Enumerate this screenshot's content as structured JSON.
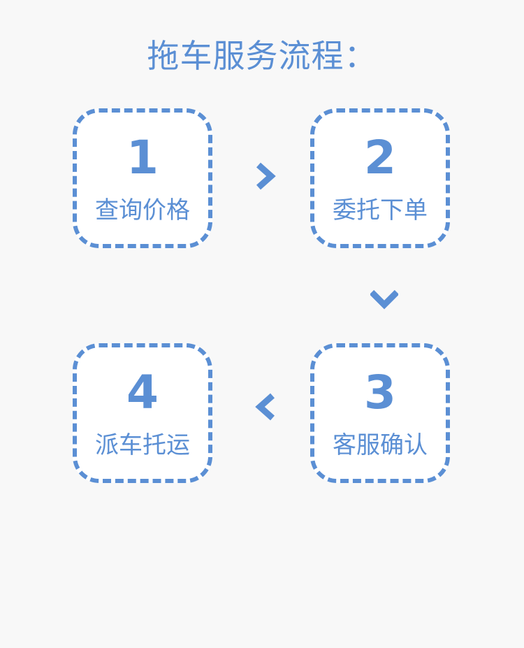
{
  "title": "拖车服务流程：",
  "colors": {
    "accent": "#5b8fd4",
    "background": "#f8f8f8",
    "card": "#ffffff"
  },
  "steps": [
    {
      "number": "1",
      "label": "查询价格"
    },
    {
      "number": "2",
      "label": "委托下单"
    },
    {
      "number": "3",
      "label": "客服确认"
    },
    {
      "number": "4",
      "label": "派车托运"
    }
  ],
  "arrows": {
    "step1_to_step2": "chevron-right-icon",
    "step2_to_step3": "chevron-down-icon",
    "step3_to_step4": "chevron-left-icon"
  }
}
